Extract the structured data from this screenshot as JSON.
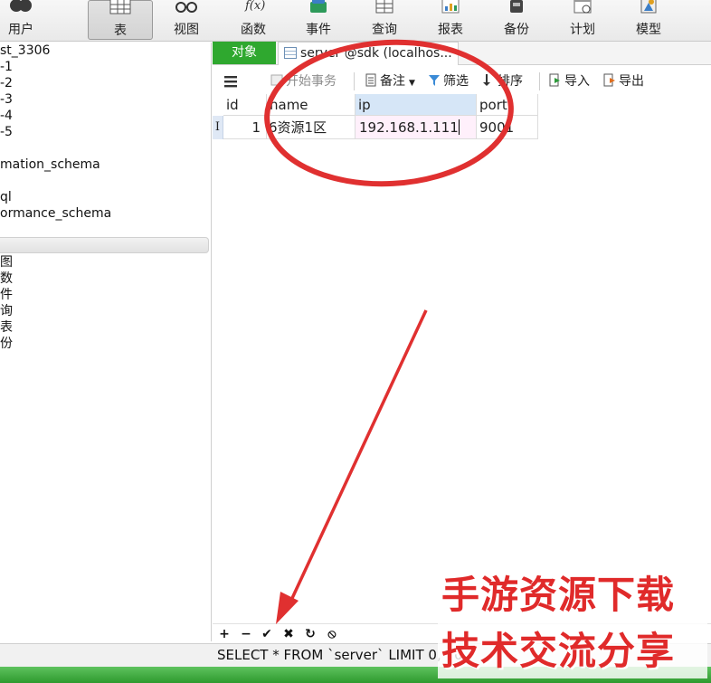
{
  "toolbar": {
    "buttons": [
      {
        "label": "用户",
        "icon": "users-icon"
      },
      {
        "label": "表",
        "icon": "table-icon",
        "active": true
      },
      {
        "label": "视图",
        "icon": "view-glasses-icon"
      },
      {
        "label": "函数",
        "icon": "function-fx-icon"
      },
      {
        "label": "事件",
        "icon": "event-icon"
      },
      {
        "label": "查询",
        "icon": "query-icon"
      },
      {
        "label": "报表",
        "icon": "report-icon"
      },
      {
        "label": "备份",
        "icon": "backup-icon"
      },
      {
        "label": "计划",
        "icon": "schedule-icon"
      },
      {
        "label": "模型",
        "icon": "model-icon"
      }
    ]
  },
  "sidebar": {
    "tree": [
      "st_3306",
      "-1",
      "-2",
      "-3",
      "-4",
      "-5",
      "mation_schema",
      "ql",
      "ormance_schema"
    ],
    "objects": [
      "图",
      "数",
      "件",
      "询",
      "表",
      "份"
    ]
  },
  "tabs": {
    "objects_label": "对象",
    "table_tab_label": "server @sdk (localhos..."
  },
  "grid_toolbar": {
    "menu_icon": "hamburger-menu-icon",
    "begin_transaction": "开始事务",
    "memo": "备注",
    "filter": "筛选",
    "sort": "排序",
    "import": "导入",
    "export": "导出"
  },
  "grid": {
    "columns": [
      "id",
      "name",
      "ip",
      "port"
    ],
    "selected_column": "ip",
    "rows": [
      {
        "marker": "I",
        "id": "1",
        "name": "6资源1区",
        "ip": "192.168.1.111",
        "port": "9001"
      }
    ]
  },
  "bottom_buttons": [
    {
      "glyph": "+",
      "icon": "add-record-icon"
    },
    {
      "glyph": "−",
      "icon": "delete-record-icon"
    },
    {
      "glyph": "✔",
      "icon": "apply-changes-icon"
    },
    {
      "glyph": "✖",
      "icon": "discard-changes-icon"
    },
    {
      "glyph": "↻",
      "icon": "refresh-icon"
    },
    {
      "glyph": "⦸",
      "icon": "stop-icon"
    }
  ],
  "status": {
    "sql": "SELECT * FROM `server` LIMIT 0, 10"
  },
  "watermark": {
    "line1": "手游资源下载",
    "line2": "技术交流分享"
  },
  "colors": {
    "objects_tab_bg": "#2fa82f",
    "annotation_red": "#e03030",
    "selected_header": "#d6e6f7",
    "editing_cell": "#fff0fb"
  }
}
